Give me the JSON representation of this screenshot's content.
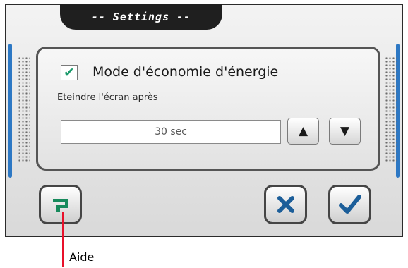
{
  "dialog": {
    "title": "-- Settings --"
  },
  "power_saving": {
    "checked": true,
    "label": "Mode d'économie d'énergie"
  },
  "screen_off": {
    "label": "Eteindre l'écran après",
    "value": "30 sec",
    "up_glyph": "▲",
    "down_glyph": "▼"
  },
  "buttons": {
    "help_icon": "help-icon",
    "cancel_icon": "close-icon",
    "ok_icon": "checkmark-icon"
  },
  "callout": {
    "label": "Aide"
  },
  "colors": {
    "frame_dark": "#1f1f1f",
    "accent_blue": "#2d78c4",
    "check_green": "#1b9a6b",
    "cancel_blue": "#1c5e99",
    "ok_blue": "#1c5e99",
    "help_green": "#178a5c",
    "callout_red": "#e8102a"
  }
}
